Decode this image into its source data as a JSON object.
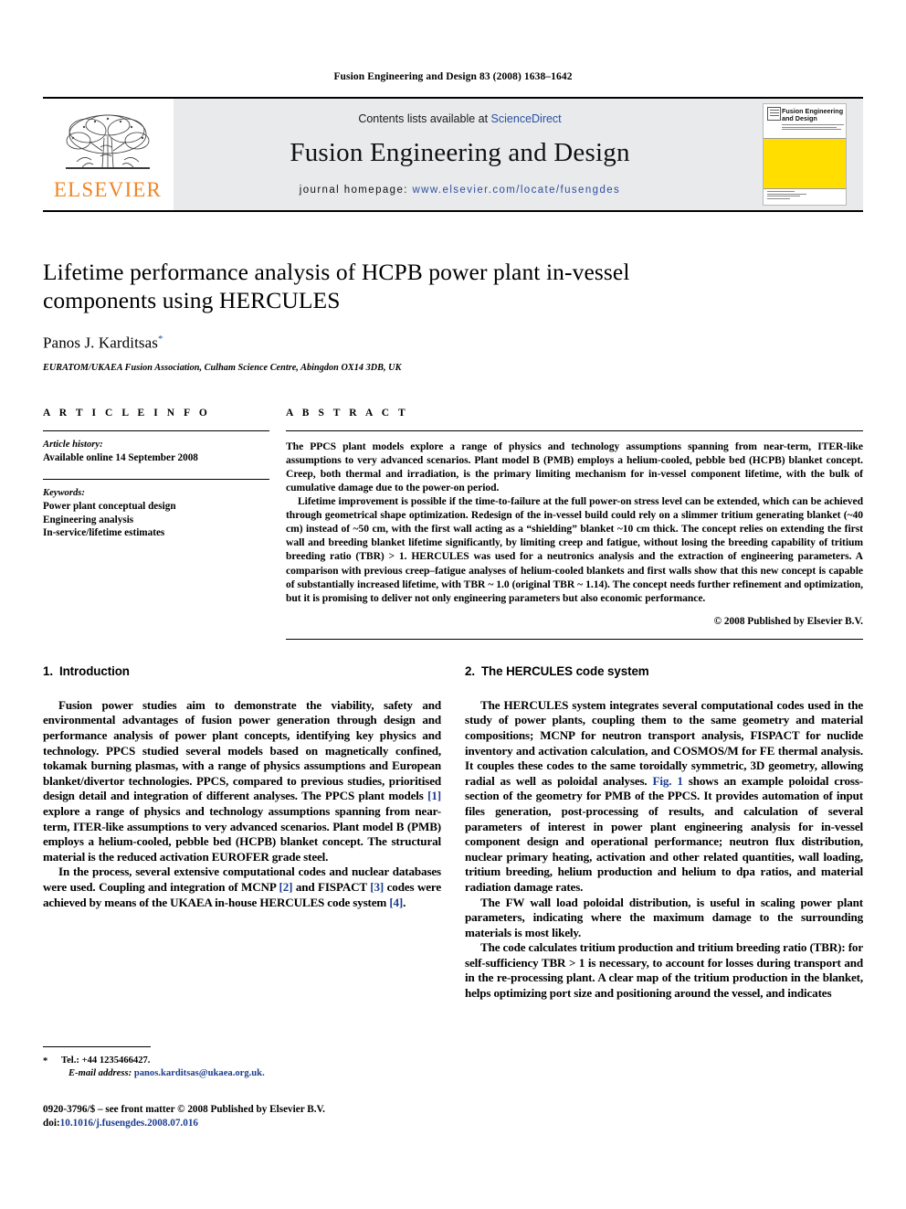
{
  "running_head": "Fusion Engineering and Design 83 (2008) 1638–1642",
  "masthead": {
    "contents_prefix": "Contents lists available at ",
    "sciencedirect": "ScienceDirect",
    "journal_name": "Fusion Engineering and Design",
    "homepage_prefix": "journal homepage: ",
    "homepage_url": "www.elsevier.com/locate/fusengdes",
    "publisher_wordmark": "ELSEVIER",
    "cover_title": "Fusion Engineering and Design",
    "brand_orange": "#f08521",
    "link_blue": "#2d4ea2",
    "cover_yellow": "#ffde00",
    "band_grey": "#e8eaec"
  },
  "article": {
    "title": "Lifetime performance analysis of HCPB power plant in-vessel components using HERCULES",
    "author": "Panos J. Karditsas",
    "author_marker": "*",
    "affiliation": "EURATOM/UKAEA Fusion Association, Culham Science Centre, Abingdon OX14 3DB, UK"
  },
  "article_info": {
    "heading": "A R T I C L E   I N F O",
    "history_label": "Article history:",
    "history_value": "Available online 14 September 2008",
    "keywords_label": "Keywords:",
    "keywords": [
      "Power plant conceptual design",
      "Engineering analysis",
      "In-service/lifetime estimates"
    ]
  },
  "abstract": {
    "heading": "A B S T R A C T",
    "paragraphs": [
      "The PPCS plant models explore a range of physics and technology assumptions spanning from near-term, ITER-like assumptions to very advanced scenarios. Plant model B (PMB) employs a helium-cooled, pebble bed (HCPB) blanket concept. Creep, both thermal and irradiation, is the primary limiting mechanism for in-vessel component lifetime, with the bulk of cumulative damage due to the power-on period.",
      "Lifetime improvement is possible if the time-to-failure at the full power-on stress level can be extended, which can be achieved through geometrical shape optimization. Redesign of the in-vessel build could rely on a slimmer tritium generating blanket (~40 cm) instead of ~50 cm, with the first wall acting as a “shielding” blanket ~10 cm thick. The concept relies on extending the first wall and breeding blanket lifetime significantly, by limiting creep and fatigue, without losing the breeding capability of tritium breeding ratio (TBR) > 1. HERCULES was used for a neutronics analysis and the extraction of engineering parameters. A comparison with previous creep–fatigue analyses of helium-cooled blankets and first walls show that this new concept is capable of substantially increased lifetime, with TBR ~ 1.0 (original TBR ~ 1.14). The concept needs further refinement and optimization, but it is promising to deliver not only engineering parameters but also economic performance."
    ],
    "copyright": "© 2008 Published by Elsevier B.V."
  },
  "sections": {
    "left": {
      "number": "1.",
      "heading": "Introduction",
      "paragraphs": [
        "Fusion power studies aim to demonstrate the viability, safety and environmental advantages of fusion power generation through design and performance analysis of power plant concepts, identifying key physics and technology. PPCS studied several models based on magnetically confined, tokamak burning plasmas, with a range of physics assumptions and European blanket/divertor technologies. PPCS, compared to previous studies, prioritised design detail and integration of different analyses. The PPCS plant models [1] explore a range of physics and technology assumptions spanning from near-term, ITER-like assumptions to very advanced scenarios. Plant model B (PMB) employs a helium-cooled, pebble bed (HCPB) blanket concept. The structural material is the reduced activation EUROFER grade steel.",
        "In the process, several extensive computational codes and nuclear databases were used. Coupling and integration of MCNP [2] and FISPACT [3] codes were achieved by means of the UKAEA in-house HERCULES code system [4]."
      ]
    },
    "right": {
      "number": "2.",
      "heading": "The HERCULES code system",
      "paragraphs": [
        "The HERCULES system integrates several computational codes used in the study of power plants, coupling them to the same geometry and material compositions; MCNP for neutron transport analysis, FISPACT for nuclide inventory and activation calculation, and COSMOS/M for FE thermal analysis. It couples these codes to the same toroidally symmetric, 3D geometry, allowing radial as well as poloidal analyses. Fig. 1 shows an example poloidal cross-section of the geometry for PMB of the PPCS. It provides automation of input files generation, post-processing of results, and calculation of several parameters of interest in power plant engineering analysis for in-vessel component design and operational performance; neutron flux distribution, nuclear primary heating, activation and other related quantities, wall loading, tritium breeding, helium production and helium to dpa ratios, and material radiation damage rates.",
        "The FW wall load poloidal distribution, is useful in scaling power plant parameters, indicating where the maximum damage to the surrounding materials is most likely.",
        "The code calculates tritium production and tritium breeding ratio (TBR): for self-sufficiency TBR > 1 is necessary, to account for losses during transport and in the re-processing plant. A clear map of the tritium production in the blanket, helps optimizing port size and positioning around the vessel, and indicates"
      ]
    }
  },
  "footnotes": {
    "star": "*",
    "tel": "Tel.: +44 1235466427.",
    "email_label": "E-mail address:",
    "email_address": "panos.karditsas@ukaea.org.uk.",
    "issn_line": "0920-3796/$ – see front matter © 2008 Published by Elsevier B.V.",
    "doi_prefix": "doi:",
    "doi_value": "10.1016/j.fusengdes.2008.07.016"
  }
}
